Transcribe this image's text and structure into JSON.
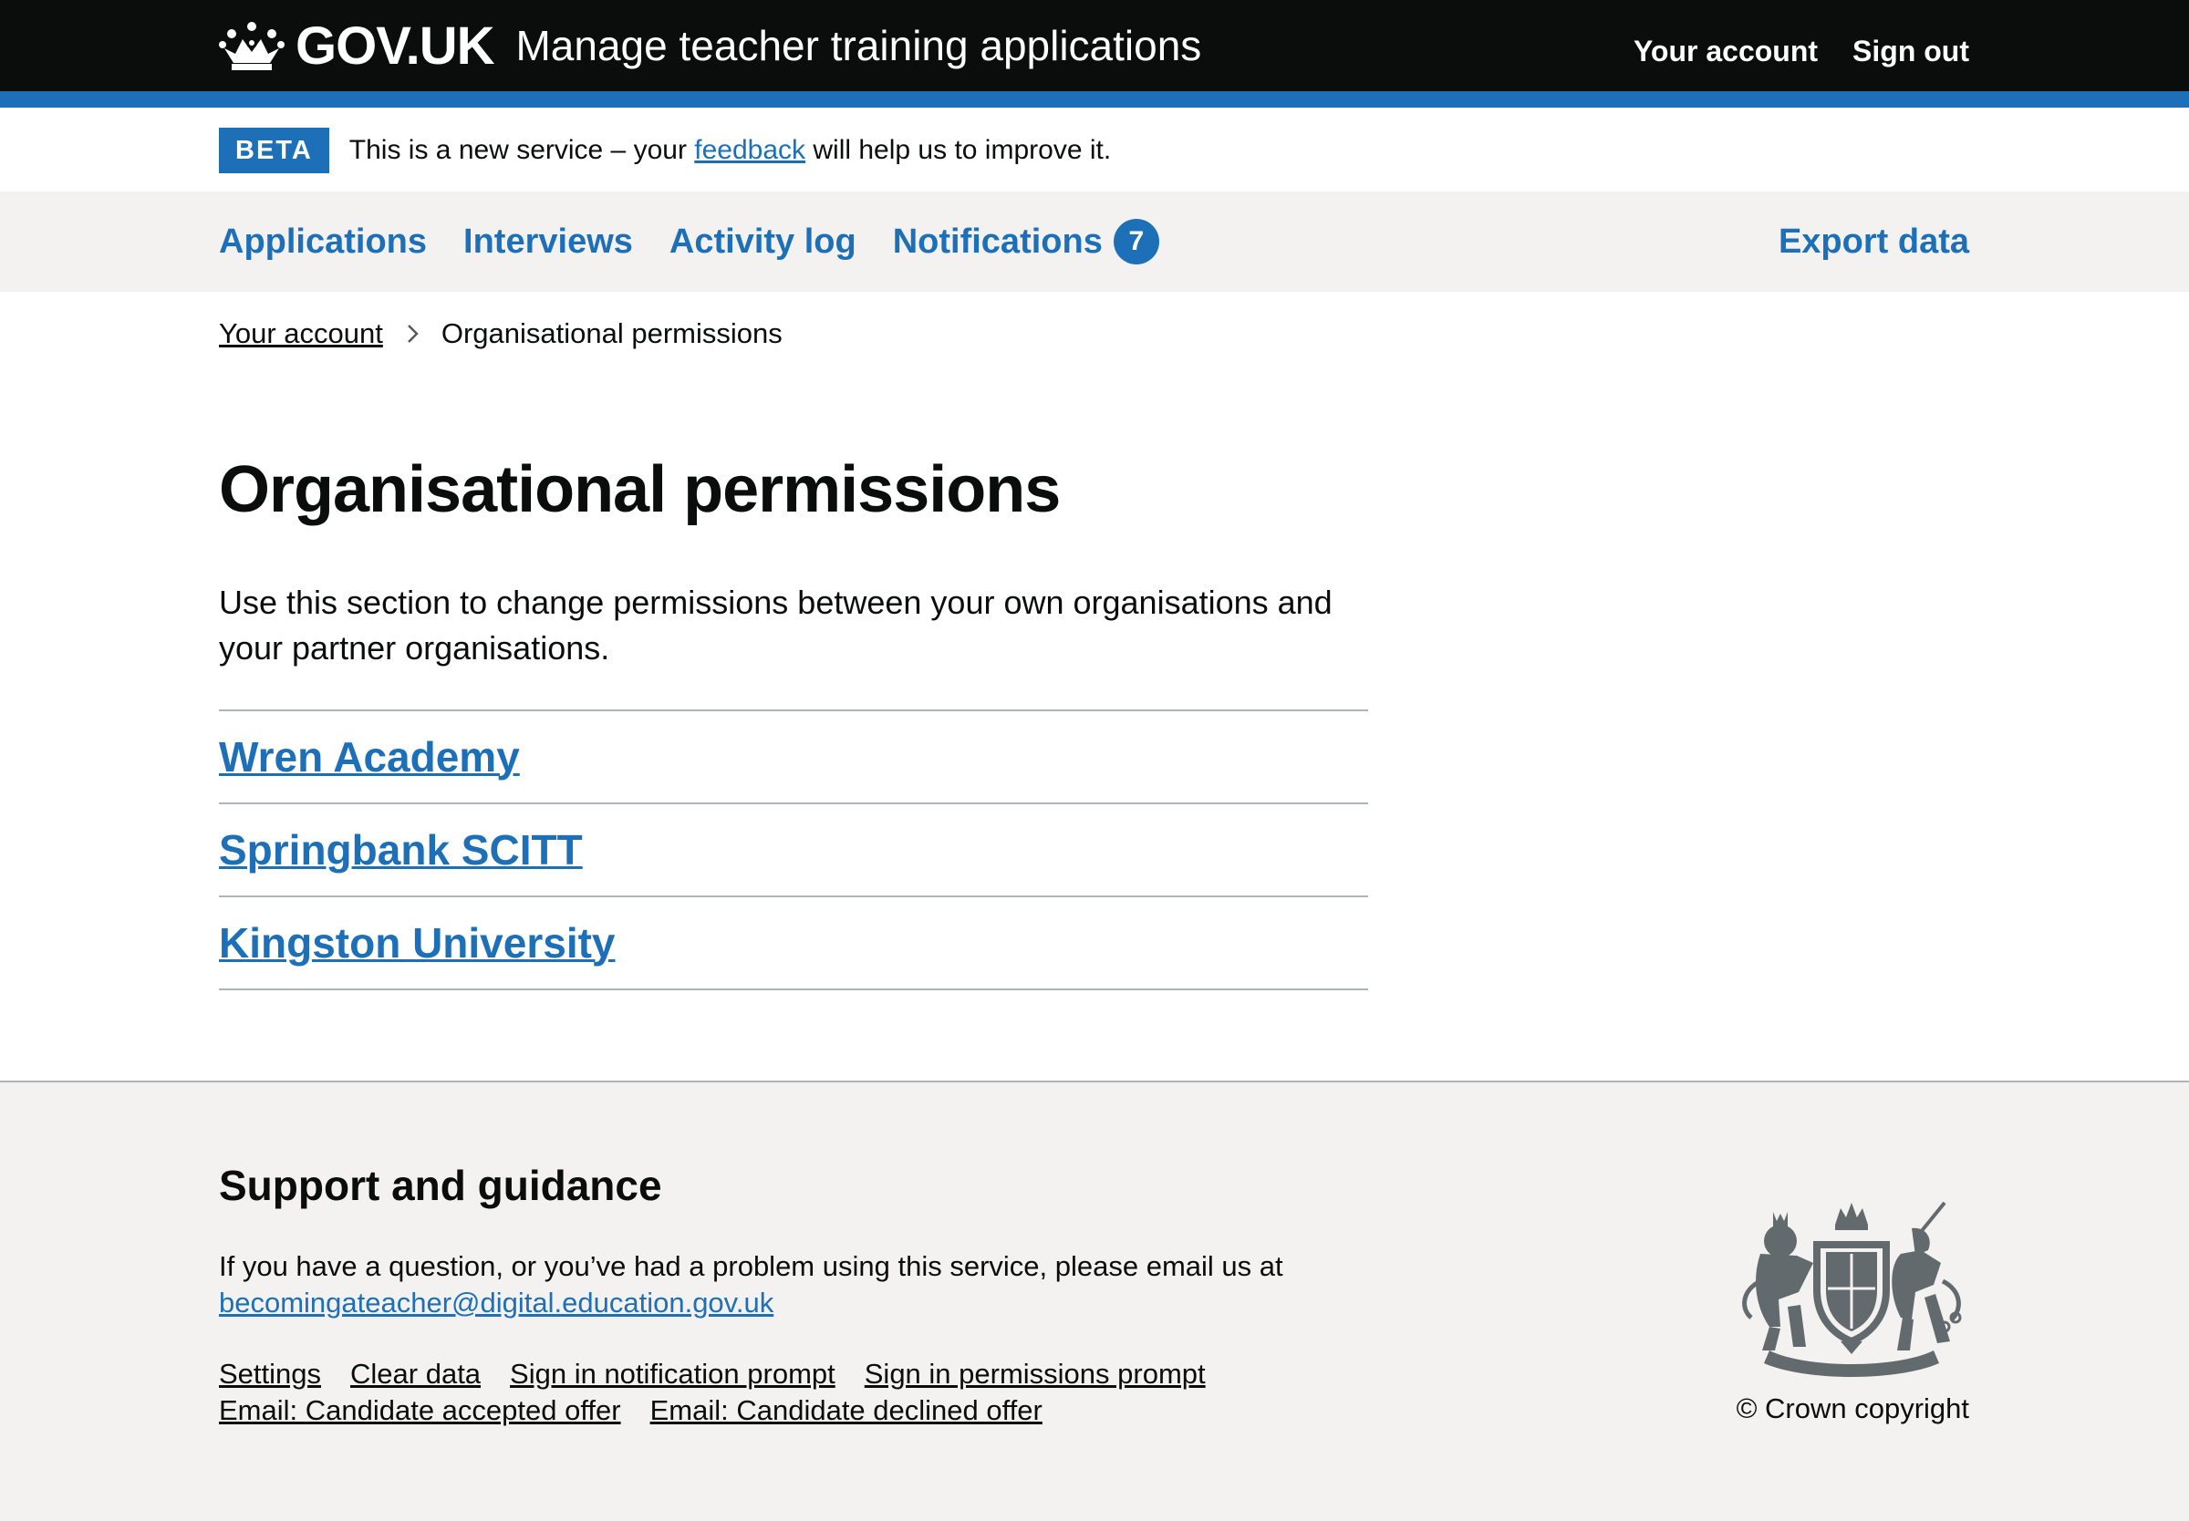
{
  "header": {
    "logo_text": "GOV.UK",
    "service_name": "Manage teacher training applications",
    "nav": [
      {
        "label": "Your account"
      },
      {
        "label": "Sign out"
      }
    ]
  },
  "phase_banner": {
    "tag": "BETA",
    "text_before": "This is a new service – your ",
    "link_text": "feedback",
    "text_after": " will help us to improve it."
  },
  "primary_nav": {
    "items": [
      {
        "label": "Applications"
      },
      {
        "label": "Interviews"
      },
      {
        "label": "Activity log"
      },
      {
        "label": "Notifications",
        "count": "7"
      }
    ],
    "export_label": "Export data"
  },
  "breadcrumb": {
    "parent": "Your account",
    "current": "Organisational permissions"
  },
  "main": {
    "title": "Organisational permissions",
    "lede": "Use this section to change permissions between your own organisations and your partner organisations.",
    "organisations": [
      {
        "name": "Wren Academy"
      },
      {
        "name": "Springbank SCITT"
      },
      {
        "name": "Kingston University"
      }
    ]
  },
  "footer": {
    "heading": "Support and guidance",
    "help_text": "If you have a question, or you’ve had a problem using this service, please email us at",
    "email": "becomingateacher@digital.education.gov.uk",
    "links": [
      {
        "label": "Settings"
      },
      {
        "label": "Clear data"
      },
      {
        "label": "Sign in notification prompt"
      },
      {
        "label": "Sign in permissions prompt"
      },
      {
        "label": "Email: Candidate accepted offer"
      },
      {
        "label": "Email: Candidate declined offer"
      }
    ],
    "copyright": "© Crown copyright"
  },
  "colors": {
    "header_bg": "#0b0c0c",
    "brand_blue": "#1d70b8",
    "nav_bg": "#f3f2f1",
    "border_grey": "#b1b4b6",
    "crest_grey": "#626a6e"
  },
  "icons": [
    "crown-icon",
    "breadcrumb-chevron-icon",
    "royal-crest-icon"
  ]
}
